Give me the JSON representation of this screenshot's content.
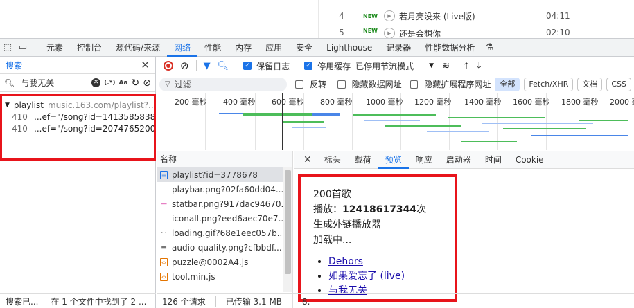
{
  "song_list": [
    {
      "num": "4",
      "tag": "NEW",
      "title": "若月亮没来 (Live版)",
      "duration": "04:11"
    },
    {
      "num": "5",
      "tag": "NEW",
      "title": "还是会想你",
      "duration": "02:10"
    }
  ],
  "main_tabs": [
    "元素",
    "控制台",
    "源代码/来源",
    "网络",
    "性能",
    "内存",
    "应用",
    "安全",
    "Lighthouse",
    "记录器",
    "性能数据分析"
  ],
  "active_main_tab": "网络",
  "search": {
    "panel_label": "搜索",
    "query": "与我无关",
    "case_label": "Aa",
    "regex_label": "(.*)",
    "result_file": "playlist",
    "result_url": "music.163.com/playlist?...",
    "lines": [
      {
        "line": "410",
        "text": "...ef=\"/song?id=1413585838..."
      },
      {
        "line": "410",
        "text": "...ef=\"/song?id=2074765200..."
      }
    ],
    "status_left": "搜索已...",
    "status_right": "在 1 个文件中找到了 2 ..."
  },
  "toolbar": {
    "preserve_log": "保留日志",
    "disable_cache": "停用缓存",
    "throttle": "已停用节流模式"
  },
  "filter": {
    "placeholder": "过滤",
    "invert": "反转",
    "hide_data_urls": "隐藏数据网址",
    "hide_ext_urls": "隐藏扩展程序网址",
    "types": [
      "全部",
      "Fetch/XHR",
      "文档",
      "CSS"
    ]
  },
  "timeline_ticks": [
    "200 毫秒",
    "400 毫秒",
    "600 毫秒",
    "800 毫秒",
    "1000 毫秒",
    "1200 毫秒",
    "1400 毫秒",
    "1600 毫秒",
    "1800 毫秒",
    "2000 毫"
  ],
  "requests": {
    "header": "名称",
    "rows": [
      {
        "name": "playlist?id=3778678",
        "kind": "doc"
      },
      {
        "name": "playbar.png?02fa60dd04...",
        "kind": "img"
      },
      {
        "name": "statbar.png?917dac94670...",
        "kind": "img"
      },
      {
        "name": "iconall.png?eed6aec70e7...",
        "kind": "img"
      },
      {
        "name": "loading.gif?68e1eec057b...",
        "kind": "gif"
      },
      {
        "name": "audio-quality.png?cfbbdf...",
        "kind": "img"
      },
      {
        "name": "puzzle@0002A4.js",
        "kind": "js"
      },
      {
        "name": "tool.min.js",
        "kind": "js"
      }
    ],
    "status": [
      "126 个请求",
      "已传输 3.1 MB",
      "8."
    ]
  },
  "detail_tabs": [
    "标头",
    "载荷",
    "预览",
    "响应",
    "启动器",
    "时间",
    "Cookie"
  ],
  "active_detail_tab": "预览",
  "preview": {
    "count": "200首歌",
    "plays_prefix": "播放：",
    "plays_value": "12418617344",
    "plays_suffix": "次",
    "embed": "生成外链播放器",
    "loading": "加载中...",
    "links": [
      "Dehors",
      "如果爱忘了 (live)",
      "与我无关"
    ]
  },
  "colors": {
    "accent": "#1a73e8",
    "highlight": "#e8141b",
    "record": "#d93025"
  }
}
